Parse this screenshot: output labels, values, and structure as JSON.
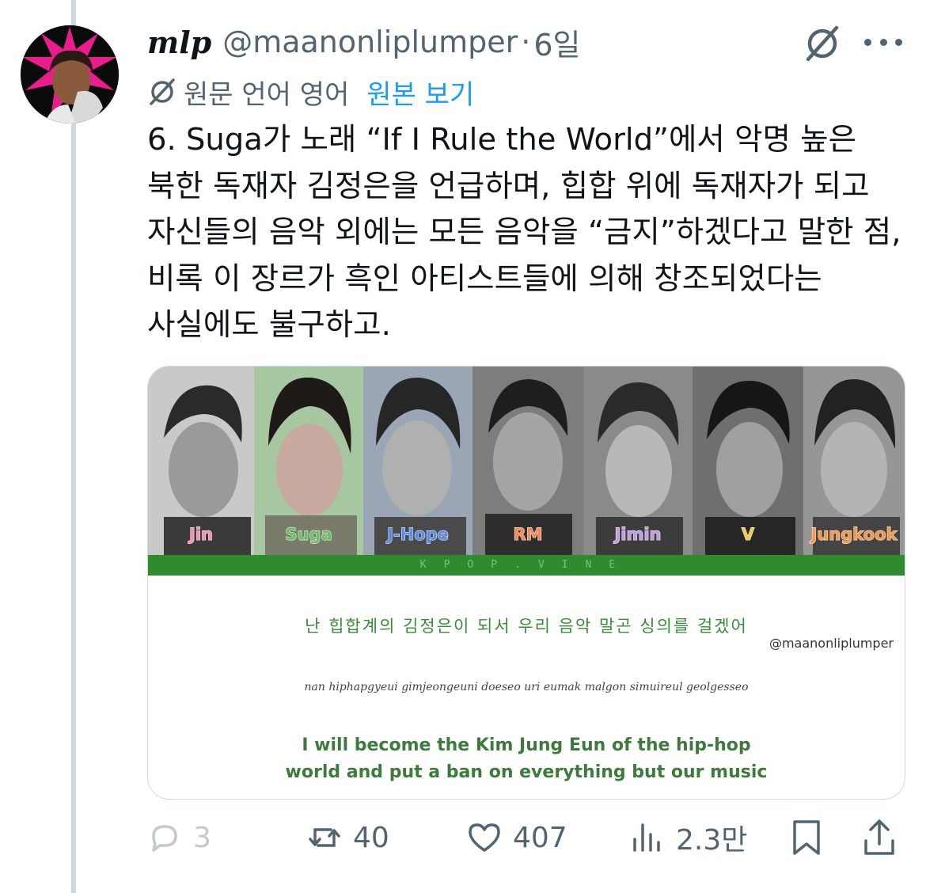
{
  "tweet": {
    "display_name": "mlp",
    "handle": "@maanonliplumper",
    "separator": "·",
    "time": "6일",
    "translation": {
      "label": "원문 언어 영어",
      "link": "원본 보기"
    },
    "text": "6. Suga가 노래 “If I Rule the World”에서 악명 높은 북한 독재자 김정은을 언급하며, 힙합 위에 독재자가 되고 자신들의 음악 외에는 모든 음악을 “금지”하겠다고 말한 점, 비록 이 장르가 흑인 아티스트들에 의해 창조되었다는 사실에도 불구하고."
  },
  "media": {
    "members": [
      {
        "name": "Jin",
        "color": "#f48fb1"
      },
      {
        "name": "Suga",
        "color": "#6bbf6b"
      },
      {
        "name": "J-Hope",
        "color": "#5c8fe0"
      },
      {
        "name": "RM",
        "color": "#f28a5a"
      },
      {
        "name": "Jimin",
        "color": "#c59be0"
      },
      {
        "name": "V",
        "color": "#f2c94c"
      },
      {
        "name": "Jungkook",
        "color": "#f2994a"
      }
    ],
    "bar_text": "KPOP.VINE",
    "lyric_korean": "난 힙합계의 김정은이 되서 우리 음악 말곤 싱의를 걸겠어",
    "lyric_handle": "@maanonliplumper",
    "lyric_romanized": "nan hiphapgyeui gimjeongeuni doeseo uri eumak malgon simuireul geolgesseo",
    "lyric_english_1": "I will become the Kim Jung Eun of the hip-hop",
    "lyric_english_2": "world and put a ban on everything but our music"
  },
  "actions": {
    "replies": "3",
    "reposts": "40",
    "likes": "407",
    "views": "2.3만"
  },
  "icons": [
    "grok-icon",
    "more-icon",
    "translate-icon",
    "reply-icon",
    "repost-icon",
    "like-icon",
    "views-icon",
    "bookmark-icon",
    "share-icon"
  ]
}
